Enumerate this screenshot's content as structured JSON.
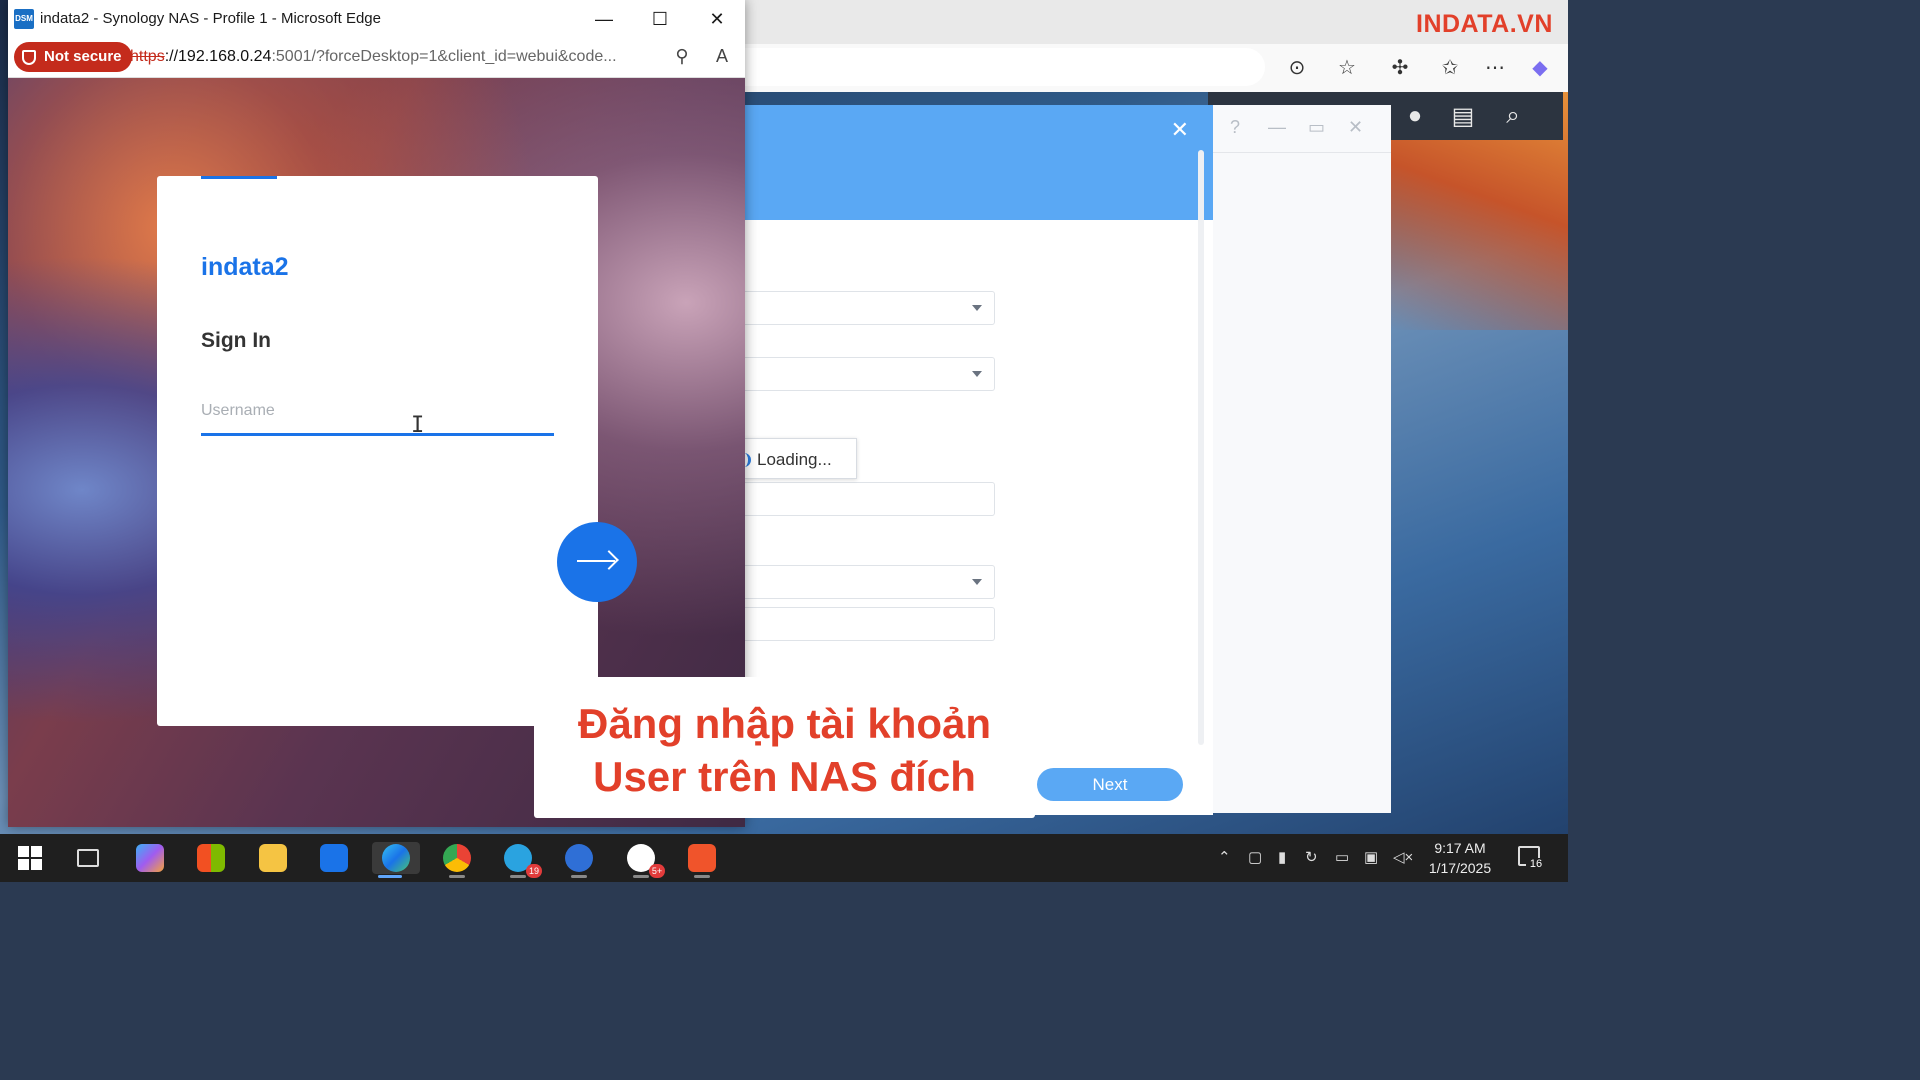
{
  "watermark": "INDATA.VN",
  "front_window": {
    "app_logo": "DSM",
    "title": "indata2 - Synology NAS - Profile 1 - Microsoft Edge",
    "security_label": "Not secure",
    "url_scheme": "https",
    "url_host": "://192.168.0.24",
    "url_rest": ":5001/?forceDesktop=1&client_id=webui&code..."
  },
  "login": {
    "hostname": "indata2",
    "heading": "Sign In",
    "username_placeholder": "Username",
    "username_value": ""
  },
  "wizard": {
    "loading_text": "Loading...",
    "next_label": "Next"
  },
  "caption": {
    "line1": "Đăng nhập tài khoản",
    "line2": "User trên NAS đích"
  },
  "taskbar": {
    "apps": [
      {
        "name": "start",
        "badge": ""
      },
      {
        "name": "task-view",
        "badge": ""
      },
      {
        "name": "copilot",
        "badge": ""
      },
      {
        "name": "microsoft-store",
        "badge": ""
      },
      {
        "name": "file-explorer",
        "badge": ""
      },
      {
        "name": "outlook",
        "badge": ""
      },
      {
        "name": "edge",
        "badge": ""
      },
      {
        "name": "chrome",
        "badge": ""
      },
      {
        "name": "telegram",
        "badge": "19"
      },
      {
        "name": "synology-finder",
        "badge": ""
      },
      {
        "name": "zalo",
        "badge": "5+"
      },
      {
        "name": "camtasia",
        "badge": ""
      }
    ],
    "clock_time": "9:17 AM",
    "clock_date": "1/17/2025",
    "notification_count": "16"
  },
  "colors": {
    "accent": "#1a73e8",
    "wizard_blue": "#5aa8f4",
    "not_secure": "#c42b1c",
    "caption_red": "#e2402a"
  }
}
